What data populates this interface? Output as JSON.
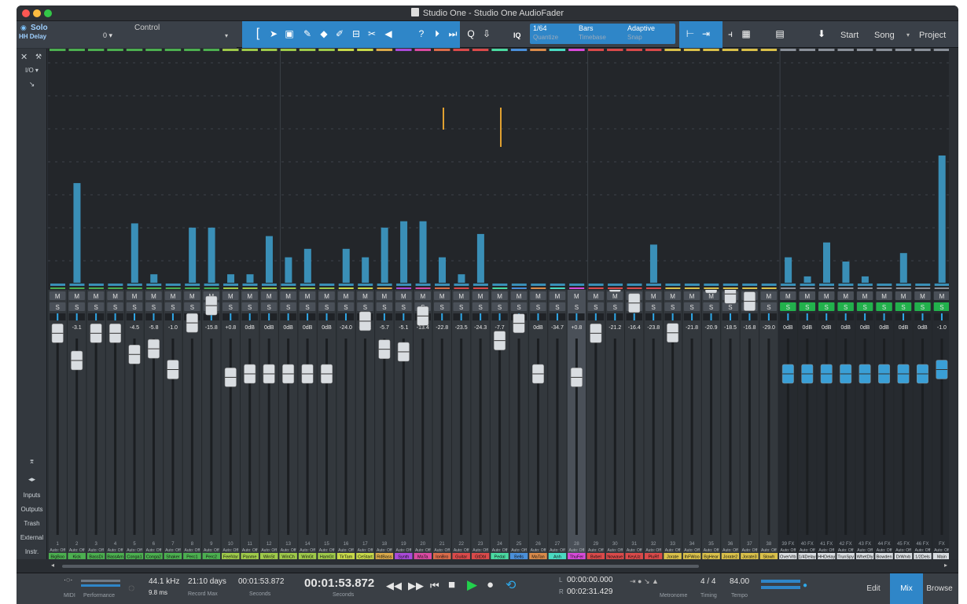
{
  "window": {
    "title": "Studio One - Studio One AudioFader"
  },
  "toolbar": {
    "solo_label": "Solo",
    "selected_track": "HH Delay",
    "control_label": "Control",
    "control_value": "0",
    "iq": "IQ",
    "quantize_value": "1/64",
    "quantize_label": "Quantize",
    "timebase_value": "Bars",
    "timebase_label": "Timebase",
    "snap_value": "Adaptive",
    "snap_label": "Snap",
    "start_label": "Start",
    "song_label": "Song",
    "project_label": "Project",
    "tool_icons": [
      "arrow-tool-icon",
      "range-tool-icon",
      "split-tool-icon",
      "eraser-tool-icon",
      "paint-tool-icon",
      "mute-tool-icon",
      "bend-tool-icon",
      "listen-tool-icon"
    ]
  },
  "sidebar": {
    "io_label": "I/O",
    "items": [
      "Inputs",
      "Outputs",
      "Trash",
      "External",
      "Instr."
    ]
  },
  "mixer": {
    "mute_label": "M",
    "solo_label": "S",
    "channels": [
      {
        "num": "1",
        "vol": "-9.4",
        "name": "BigBoo",
        "color": "#4caf50",
        "meter": 0.0
      },
      {
        "num": "2",
        "vol": "-3.1",
        "name": "Kick",
        "color": "#4caf50",
        "meter": 0.47
      },
      {
        "num": "3",
        "vol": "-9.4",
        "name": "BassDi",
        "color": "#4caf50",
        "meter": 0.0
      },
      {
        "num": "4",
        "vol": "-9.4",
        "name": "BassAm",
        "color": "#4caf50",
        "meter": 0.0
      },
      {
        "num": "5",
        "vol": "-4.5",
        "name": "Conga1",
        "color": "#4caf50",
        "meter": 0.28
      },
      {
        "num": "6",
        "vol": "-5.8",
        "name": "Conga2",
        "color": "#4caf50",
        "meter": 0.04
      },
      {
        "num": "7",
        "vol": "-1.0",
        "name": "Shaker",
        "color": "#4caf50",
        "meter": 0.0
      },
      {
        "num": "8",
        "vol": "-11.8",
        "name": "Perc1",
        "color": "#4caf50",
        "meter": 0.26
      },
      {
        "num": "9",
        "vol": "-15.8",
        "name": "Perc2",
        "color": "#4caf50",
        "meter": 0.26
      },
      {
        "num": "10",
        "vol": "+0.8",
        "name": "FeelVar",
        "color": "#9ec94a",
        "meter": 0.04
      },
      {
        "num": "11",
        "vol": "0dB",
        "name": "Panme",
        "color": "#9ec94a",
        "meter": 0.04
      },
      {
        "num": "12",
        "vol": "0dB",
        "name": "WinSt",
        "color": "#9ec94a",
        "meter": 0.22
      },
      {
        "num": "13",
        "vol": "0dB",
        "name": "WinCh",
        "color": "#9ec94a",
        "meter": 0.12
      },
      {
        "num": "14",
        "vol": "0dB",
        "name": "WinGt",
        "color": "#9ec94a",
        "meter": 0.16
      },
      {
        "num": "15",
        "vol": "0dB",
        "name": "HamGt",
        "color": "#9ec94a",
        "meter": 0.0
      },
      {
        "num": "16",
        "vol": "-24.0",
        "name": "TirTam",
        "color": "#c7d94a",
        "meter": 0.16
      },
      {
        "num": "17",
        "vol": "-12.2",
        "name": "CeStart",
        "color": "#c7d94a",
        "meter": 0.12
      },
      {
        "num": "18",
        "vol": "-5.7",
        "name": "RdBass",
        "color": "#d9a94a",
        "meter": 0.26
      },
      {
        "num": "19",
        "vol": "-5.1",
        "name": "Synth",
        "color": "#a94ad9",
        "meter": 0.29
      },
      {
        "num": "20",
        "vol": "-13.4",
        "name": "MaTa",
        "color": "#d94aa1",
        "meter": 0.29
      },
      {
        "num": "21",
        "vol": "-22.8",
        "name": "IonBro",
        "color": "#d96b4a",
        "meter": 0.12
      },
      {
        "num": "22",
        "vol": "-23.5",
        "name": "Guitar",
        "color": "#d94a4a",
        "meter": 0.04
      },
      {
        "num": "23",
        "vol": "-24.3",
        "name": "GtDbl",
        "color": "#d94a4a",
        "meter": 0.23
      },
      {
        "num": "24",
        "vol": "-7.7",
        "name": "Pedal",
        "color": "#4ad9a1",
        "meter": 0.0
      },
      {
        "num": "25",
        "vol": "-11.7",
        "name": "Bells",
        "color": "#4a8fd9",
        "meter": 0.0
      },
      {
        "num": "26",
        "vol": "0dB",
        "name": "MaTan",
        "color": "#d98a4a",
        "meter": 0.0
      },
      {
        "num": "27",
        "vol": "-34.7",
        "name": "Anh",
        "color": "#4ad9c1",
        "meter": 0.0
      },
      {
        "num": "28",
        "vol": "+0.8",
        "name": "ThuFer",
        "color": "#d94ad9",
        "meter": 0.0
      },
      {
        "num": "29",
        "vol": "-9.4",
        "name": "Bvbel",
        "color": "#d94a4a",
        "meter": 0.0
      },
      {
        "num": "30",
        "vol": "-21.2",
        "name": "Nowave",
        "color": "#d94a4a",
        "meter": 0.0
      },
      {
        "num": "31",
        "vol": "-16.4",
        "name": "KeyUz",
        "color": "#d94a4a",
        "meter": 0.0
      },
      {
        "num": "32",
        "vol": "-23.8",
        "name": "PluRf",
        "color": "#d94a4a",
        "meter": 0.18
      },
      {
        "num": "33",
        "vol": "-9.5",
        "name": "Jorate",
        "color": "#d9c04a",
        "meter": 0.0
      },
      {
        "num": "34",
        "vol": "-21.8",
        "name": "IhFWoo",
        "color": "#d9c04a",
        "meter": 0.0
      },
      {
        "num": "35",
        "vol": "-20.9",
        "name": "BgHear",
        "color": "#d9c04a",
        "meter": 0.0
      },
      {
        "num": "36",
        "vol": "-18.5",
        "name": "Jorate2",
        "color": "#d9c04a",
        "meter": 0.0
      },
      {
        "num": "37",
        "vol": "-16.8",
        "name": "Jorate3",
        "color": "#d9c04a",
        "meter": 0.0
      },
      {
        "num": "38",
        "vol": "-29.0",
        "name": "Slowh",
        "color": "#d9c04a",
        "meter": 0.0
      }
    ],
    "fx_channels": [
      {
        "num": "39 FX",
        "vol": "0dB",
        "name": "OverVrb",
        "meter": 0.12
      },
      {
        "num": "40 FX",
        "vol": "0dB",
        "name": "1/4Delay",
        "meter": 0.03
      },
      {
        "num": "41 FX",
        "vol": "0dB",
        "name": "HHDelay",
        "meter": 0.19
      },
      {
        "num": "42 FX",
        "vol": "0dB",
        "name": "TrunSpy",
        "meter": 0.1
      },
      {
        "num": "43 FX",
        "vol": "0dB",
        "name": "WhetDly",
        "meter": 0.03
      },
      {
        "num": "44 FX",
        "vol": "0dB",
        "name": "Bowden",
        "meter": 0.0
      },
      {
        "num": "45 FX",
        "vol": "0dB",
        "name": "DrWrvb",
        "meter": 0.14
      },
      {
        "num": "46 FX",
        "vol": "0dB",
        "name": "1/2Dels",
        "meter": 0.0
      },
      {
        "num": "FX",
        "vol": "-1.0",
        "name": "Main",
        "meter": 0.6
      }
    ],
    "auto_label": "Auto: Off",
    "read_label": "Read"
  },
  "transport": {
    "midi_label": "MIDI",
    "performance_label": "Performance",
    "sample_rate": "44.1 kHz",
    "latency": "9.8 ms",
    "record_max_value": "21:10 days",
    "record_max_label": "Record Max",
    "seconds_small": "00:01:53.872",
    "seconds_small_label": "Seconds",
    "time_main": "00:01:53.872",
    "time_main_label": "Seconds",
    "loop_l": "00:00:00.000",
    "loop_r": "00:02:31.429",
    "l_label": "L",
    "r_label": "R",
    "metronome_label": "Metronome",
    "timing_value": "4 / 4",
    "timing_label": "Timing",
    "tempo_value": "84.00",
    "tempo_label": "Tempo",
    "edit_label": "Edit",
    "mix_label": "Mix",
    "browse_label": "Browse"
  },
  "colors": {
    "accent": "#2f86c8",
    "solo_active": "#22b14c",
    "meter": "#3a8fb7"
  }
}
